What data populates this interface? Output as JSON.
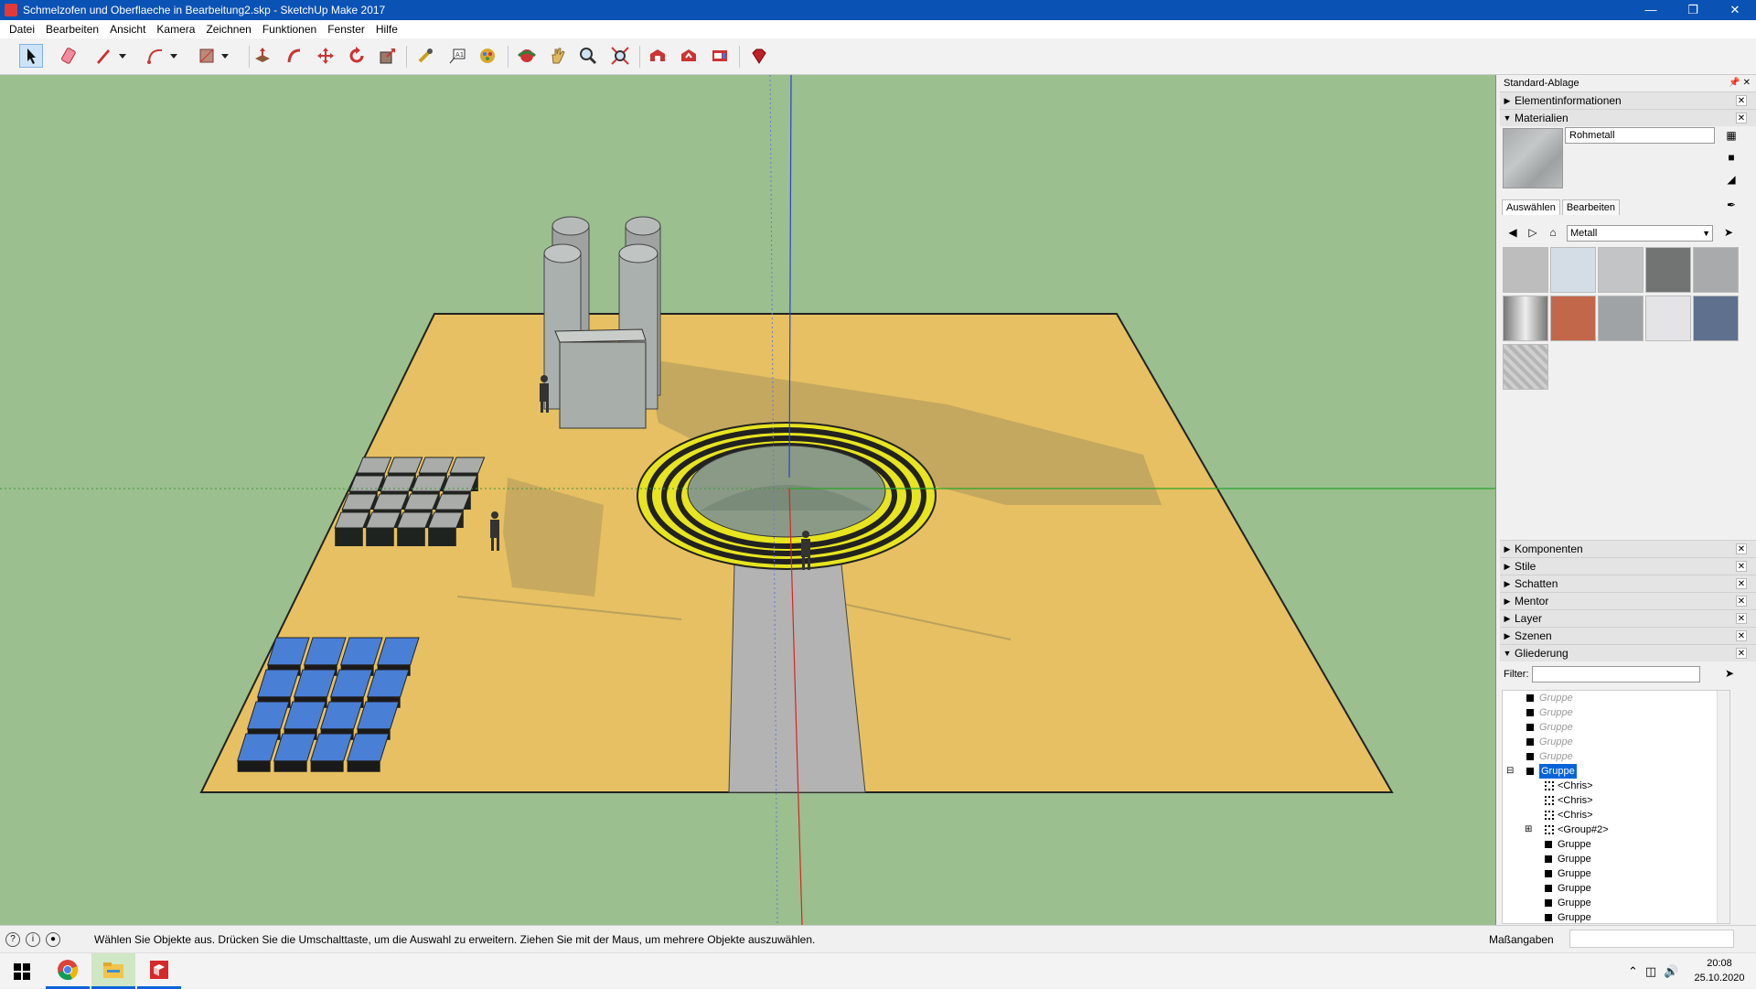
{
  "window": {
    "title": "Schmelzofen und Oberflaeche in Bearbeitung2.skp - SketchUp Make 2017",
    "controls": [
      "minimize-icon",
      "restore-icon",
      "close-icon"
    ]
  },
  "menu": {
    "items": [
      "Datei",
      "Bearbeiten",
      "Ansicht",
      "Kamera",
      "Zeichnen",
      "Funktionen",
      "Fenster",
      "Hilfe"
    ]
  },
  "toolbar": {
    "tools": [
      "select-icon",
      "eraser-icon",
      "pencil-icon",
      "arc-icon",
      "rectangle-icon",
      "push-pull-icon",
      "follow-me-icon",
      "move-icon",
      "rotate-icon",
      "scale-icon",
      "tape-measure-icon",
      "text-icon",
      "paint-bucket-icon",
      "orbit-icon",
      "pan-icon",
      "zoom-icon",
      "zoom-extents-icon",
      "warehouse-icon",
      "share-model-icon",
      "extension-warehouse-icon",
      "ruby-icon"
    ]
  },
  "tray": {
    "title": "Standard-Ablage",
    "panels_top": [
      {
        "label": "Elementinformationen",
        "expanded": false
      },
      {
        "label": "Materialien",
        "expanded": true
      }
    ],
    "materials": {
      "current_name": "Rohmetall",
      "tabs": [
        "Auswählen",
        "Bearbeiten"
      ],
      "active_tab": "Auswählen",
      "library": "Metall",
      "swatches": [
        "#bdbdbd",
        "#d4dde6",
        "#c2c4c6",
        "#727373",
        "#a8aaab",
        "#9b9b9b",
        "#c2674a",
        "#9fa3a6",
        "#e4e4e6",
        "#5f6f8e",
        "#cfcfcf"
      ]
    },
    "panels_bottom": [
      {
        "label": "Komponenten",
        "expanded": false
      },
      {
        "label": "Stile",
        "expanded": false
      },
      {
        "label": "Schatten",
        "expanded": false
      },
      {
        "label": "Mentor",
        "expanded": false
      },
      {
        "label": "Layer",
        "expanded": false
      },
      {
        "label": "Szenen",
        "expanded": false
      },
      {
        "label": "Gliederung",
        "expanded": true
      }
    ],
    "outliner": {
      "filter_label": "Filter:",
      "rows": [
        {
          "label": "Gruppe",
          "style": "faded",
          "icon": "square"
        },
        {
          "label": "Gruppe",
          "style": "faded",
          "icon": "square"
        },
        {
          "label": "Gruppe",
          "style": "faded",
          "icon": "square"
        },
        {
          "label": "Gruppe",
          "style": "faded",
          "icon": "square"
        },
        {
          "label": "Gruppe",
          "style": "faded",
          "icon": "square"
        },
        {
          "label": "Gruppe",
          "style": "selected",
          "icon": "square"
        },
        {
          "label": "<Chris>",
          "style": "normal",
          "icon": "component"
        },
        {
          "label": "<Chris>",
          "style": "normal",
          "icon": "component"
        },
        {
          "label": "<Chris>",
          "style": "normal",
          "icon": "component"
        },
        {
          "label": "<Group#2>",
          "style": "normal",
          "icon": "component"
        },
        {
          "label": "Gruppe",
          "style": "normal",
          "icon": "square"
        },
        {
          "label": "Gruppe",
          "style": "normal",
          "icon": "square"
        },
        {
          "label": "Gruppe",
          "style": "normal",
          "icon": "square"
        },
        {
          "label": "Gruppe",
          "style": "normal",
          "icon": "square"
        },
        {
          "label": "Gruppe",
          "style": "normal",
          "icon": "square"
        },
        {
          "label": "Gruppe",
          "style": "normal",
          "icon": "square"
        }
      ]
    }
  },
  "status": {
    "message": "Wählen Sie Objekte aus. Drücken Sie die Umschalttaste, um die Auswahl zu erweitern. Ziehen Sie mit der Maus, um mehrere Objekte auszuwählen.",
    "measurements_label": "Maßangaben"
  },
  "taskbar": {
    "apps": [
      "windows-start-icon",
      "chrome-icon",
      "file-explorer-icon",
      "sketchup-icon"
    ],
    "time": "20:08",
    "date": "25.10.2020"
  },
  "colors": {
    "sky": "#9bbf8f",
    "ground": "#e6c062",
    "accent_yellow": "#e7e420",
    "selection": "#0a64d8"
  }
}
